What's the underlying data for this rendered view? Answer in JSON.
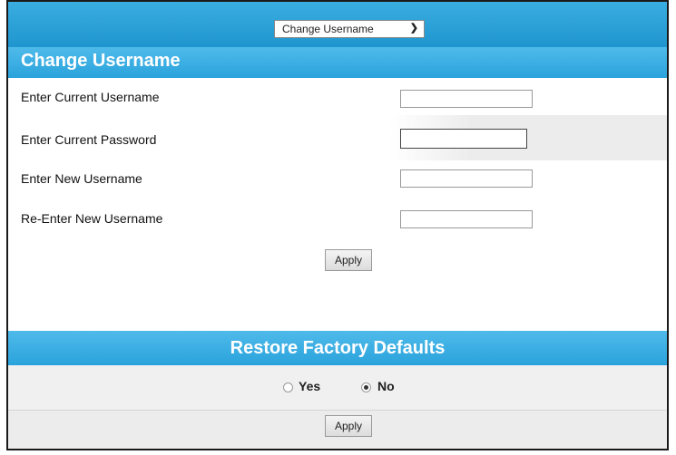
{
  "nav": {
    "select_value": "Change Username"
  },
  "change_username": {
    "title": "Change Username",
    "fields": [
      {
        "label": "Enter Current Username",
        "value": ""
      },
      {
        "label": "Enter Current Password",
        "value": ""
      },
      {
        "label": "Enter New Username",
        "value": ""
      },
      {
        "label": "Re-Enter New Username",
        "value": ""
      }
    ],
    "apply_label": "Apply"
  },
  "restore": {
    "title": "Restore Factory Defaults",
    "options": [
      {
        "label": "Yes",
        "checked": false
      },
      {
        "label": "No",
        "checked": true
      }
    ],
    "apply_label": "Apply"
  },
  "colors": {
    "header_blue": "#2aa3dc",
    "frame": "#1a1a1a"
  }
}
